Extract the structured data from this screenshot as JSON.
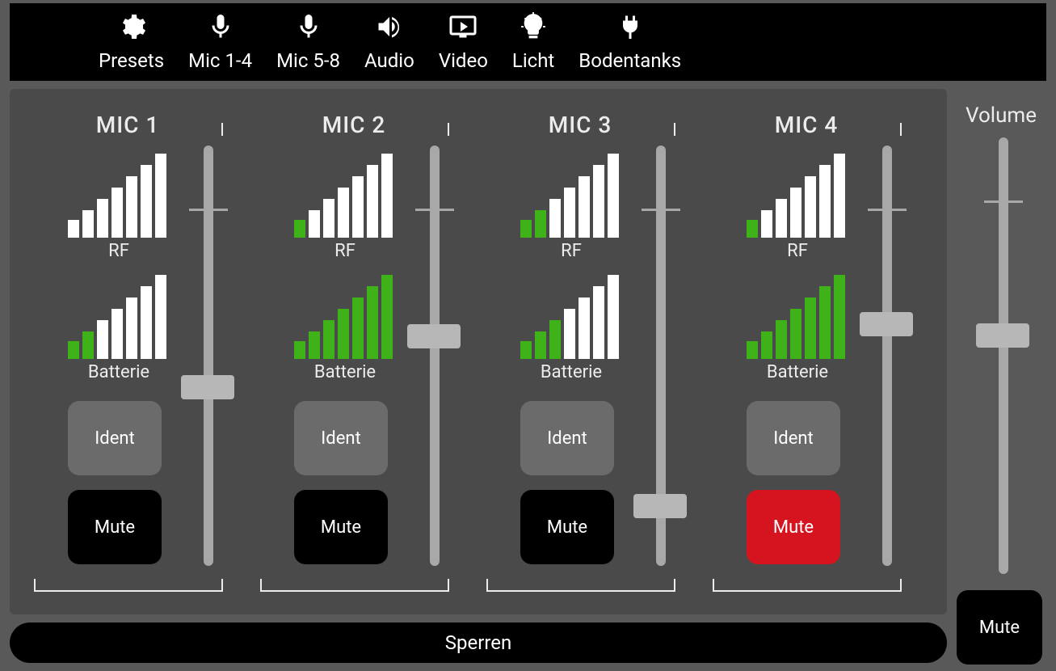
{
  "nav": [
    {
      "label": "Presets",
      "icon": "gear"
    },
    {
      "label": "Mic 1-4",
      "icon": "mic"
    },
    {
      "label": "Mic 5-8",
      "icon": "mic"
    },
    {
      "label": "Audio",
      "icon": "speaker"
    },
    {
      "label": "Video",
      "icon": "screen"
    },
    {
      "label": "Licht",
      "icon": "bulb"
    },
    {
      "label": "Bodentanks",
      "icon": "plug"
    }
  ],
  "labels": {
    "rf": "RF",
    "batterie": "Batterie",
    "ident": "Ident",
    "mute": "Mute",
    "volume": "Volume",
    "sperren": "Sperren"
  },
  "mics": [
    {
      "title": "MIC 1",
      "rf_green": 0,
      "bat_green": 2,
      "mute_active": false,
      "slider": 0.42
    },
    {
      "title": "MIC 2",
      "rf_green": 1,
      "bat_green": 7,
      "mute_active": false,
      "slider": 0.55
    },
    {
      "title": "MIC 3",
      "rf_green": 2,
      "bat_green": 3,
      "mute_active": false,
      "slider": 0.12
    },
    {
      "title": "MIC 4",
      "rf_green": 1,
      "bat_green": 7,
      "mute_active": true,
      "slider": 0.58
    }
  ],
  "master": {
    "slider": 0.55,
    "mute_active": false
  },
  "colors": {
    "green": "#3fb219",
    "red": "#d51420",
    "panel": "#4a4a4a",
    "bg": "#595959"
  }
}
